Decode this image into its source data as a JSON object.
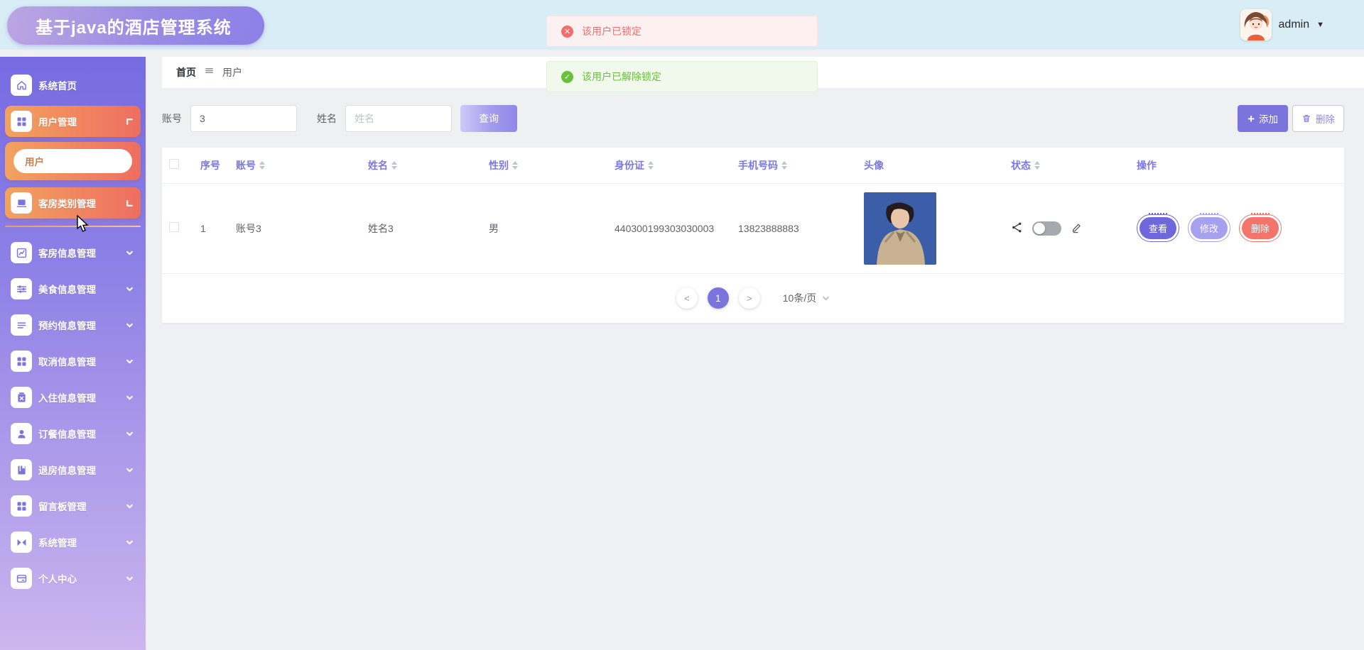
{
  "header": {
    "title": "基于java的酒店管理系统",
    "username": "admin",
    "caret": "▼"
  },
  "toasts": {
    "error_text": "该用户已锁定",
    "success_text": "该用户已解除锁定"
  },
  "breadcrumb": {
    "home": "首页",
    "current": "用户"
  },
  "sidebar": {
    "items": [
      {
        "label": "系统首页",
        "icon": "home-icon"
      },
      {
        "label": "用户管理",
        "icon": "grid-icon",
        "state": "active-expanded"
      },
      {
        "label": "客房类别管理",
        "icon": "laptop-icon",
        "state": "active-expanded"
      },
      {
        "label": "客房信息管理",
        "icon": "chart-icon"
      },
      {
        "label": "美食信息管理",
        "icon": "sliders-icon"
      },
      {
        "label": "预约信息管理",
        "icon": "list-icon"
      },
      {
        "label": "取消信息管理",
        "icon": "grid-icon"
      },
      {
        "label": "入住信息管理",
        "icon": "clipboard-x-icon"
      },
      {
        "label": "订餐信息管理",
        "icon": "user-icon"
      },
      {
        "label": "退房信息管理",
        "icon": "book-icon"
      },
      {
        "label": "留言板管理",
        "icon": "grid-icon"
      },
      {
        "label": "系统管理",
        "icon": "switch-icon"
      },
      {
        "label": "个人中心",
        "icon": "card-icon"
      }
    ],
    "submenu": {
      "label": "用户"
    }
  },
  "filters": {
    "account_label": "账号",
    "account_value": "3",
    "name_label": "姓名",
    "name_placeholder": "姓名",
    "search_button": "查询"
  },
  "toolbar": {
    "add_button": "添加",
    "delete_button": "删除"
  },
  "table": {
    "headers": [
      "序号",
      "账号",
      "姓名",
      "性别",
      "身份证",
      "手机号码",
      "头像",
      "状态",
      "操作"
    ],
    "rows": [
      {
        "no": "1",
        "account": "账号3",
        "name": "姓名3",
        "gender": "男",
        "id_card": "440300199303030003",
        "phone": "13823888883"
      }
    ],
    "row_actions": {
      "view": "查看",
      "edit": "修改",
      "delete": "删除"
    }
  },
  "pagination": {
    "prev": "<",
    "current_page": "1",
    "next": ">",
    "page_size": "10条/页"
  },
  "colors": {
    "brand_purple": "#7b74dd",
    "active_orange_start": "#f2a25f",
    "active_orange_end": "#ee6e60",
    "error_red": "#f56c6c",
    "success_green": "#67c23a",
    "header_bg": "#d9edf6",
    "sidebar_top": "#766be2",
    "sidebar_bottom": "#cbb6ee"
  }
}
